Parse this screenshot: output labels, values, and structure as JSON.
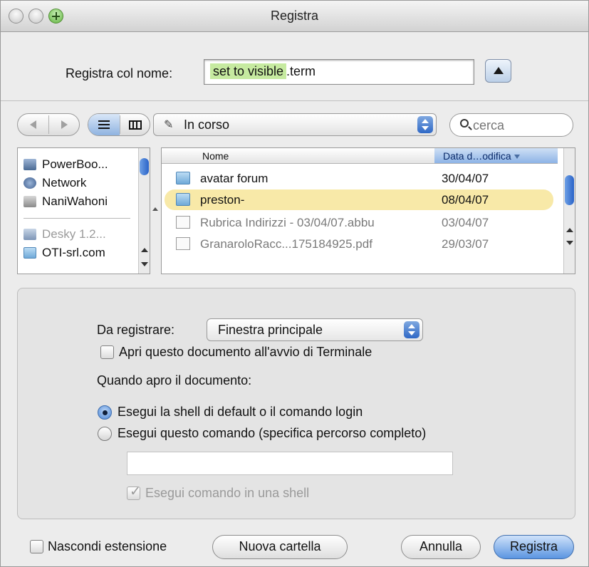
{
  "window": {
    "title": "Registra"
  },
  "save_as": {
    "label": "Registra col nome:",
    "value_selected": "set to visible",
    "value_extension": ".term"
  },
  "toolbar": {
    "location": "In corso",
    "search_placeholder": "cerca"
  },
  "sidebar": {
    "items": [
      {
        "label": "PowerBoo...",
        "icon": "computer-icon"
      },
      {
        "label": "Network",
        "icon": "network-icon"
      },
      {
        "label": "NaniWahoni",
        "icon": "disk-icon"
      },
      {
        "label": "Desky 1.2...",
        "icon": "disk-image-icon"
      },
      {
        "label": "OTI-srl.com",
        "icon": "folder-icon"
      }
    ]
  },
  "file_list": {
    "col_name": "Nome",
    "col_date": "Data d…odifica",
    "rows": [
      {
        "name": "avatar forum",
        "date": "30/04/07",
        "kind": "folder",
        "selected": false,
        "enabled": true
      },
      {
        "name": "preston-",
        "date": "08/04/07",
        "kind": "folder",
        "selected": true,
        "enabled": true
      },
      {
        "name": "Rubrica Indirizzi - 03/04/07.abbu",
        "date": "03/04/07",
        "kind": "document",
        "selected": false,
        "enabled": false
      },
      {
        "name": "GranaroloRacc...175184925.pdf",
        "date": "29/03/07",
        "kind": "document",
        "selected": false,
        "enabled": false
      }
    ]
  },
  "options": {
    "to_save_label": "Da registrare:",
    "to_save_value": "Finestra principale",
    "open_at_startup": "Apri questo documento all'avvio di Terminale",
    "when_open_label": "Quando apro il documento:",
    "radio_default": "Esegui la shell di default o il comando login",
    "radio_command": "Esegui questo comando (specifica percorso completo)",
    "command_value": "",
    "run_in_shell": "Esegui comando in una shell"
  },
  "bottom": {
    "hide_extension": "Nascondi estensione",
    "new_folder": "Nuova cartella",
    "cancel": "Annulla",
    "save": "Registra"
  },
  "colors": {
    "selection_highlight": "#c6eaa0",
    "row_selected": "#f8e9a8",
    "accent_blue": "#5b95e1"
  }
}
